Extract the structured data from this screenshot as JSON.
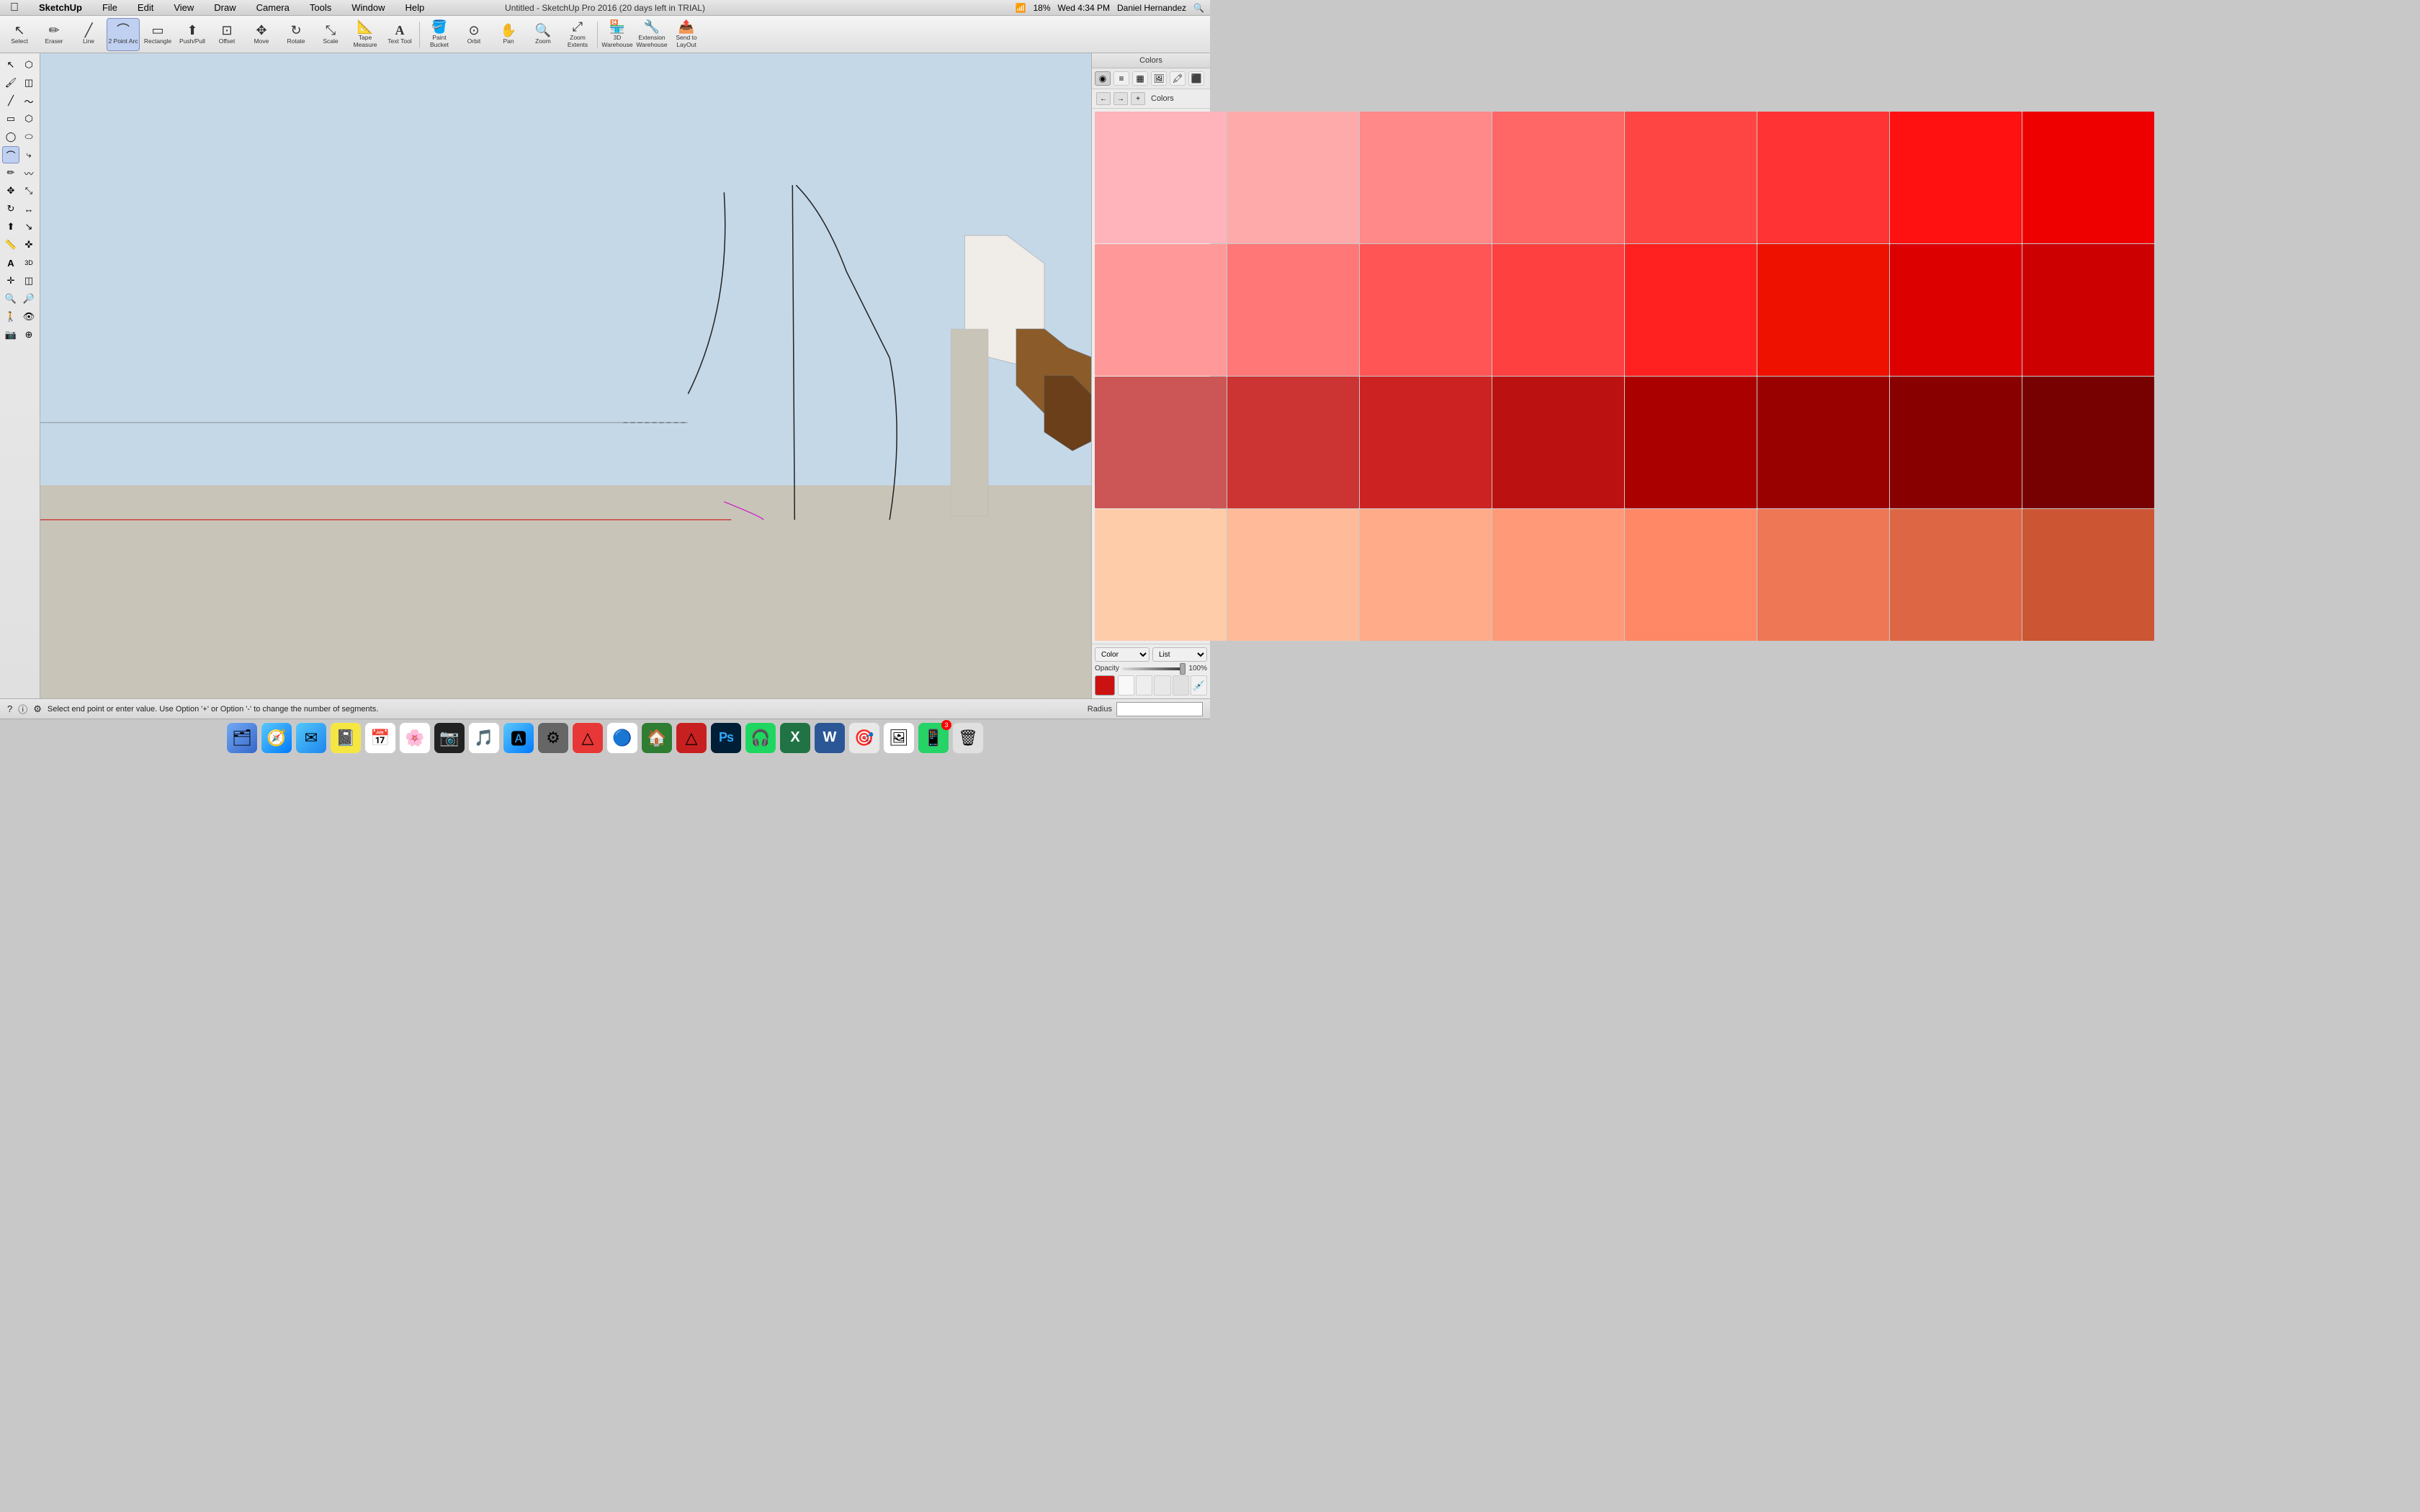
{
  "app": {
    "name": "SketchUp",
    "title": "Untitled - SketchUp Pro 2016 (20 days left in TRIAL)",
    "version": "2016"
  },
  "menubar": {
    "apple_label": "",
    "items": [
      "SketchUp",
      "File",
      "Edit",
      "View",
      "Draw",
      "Camera",
      "Tools",
      "Window",
      "Help"
    ],
    "time": "Wed 4:34 PM",
    "user": "Daniel Hernandez",
    "battery": "18%"
  },
  "toolbar": {
    "tools": [
      {
        "id": "select",
        "label": "Select",
        "icon": "↖",
        "active": false
      },
      {
        "id": "eraser",
        "label": "Eraser",
        "icon": "⌫",
        "active": false
      },
      {
        "id": "line",
        "label": "Line",
        "icon": "╱",
        "active": false
      },
      {
        "id": "2point-arc",
        "label": "2 Point Arc",
        "icon": "⌒",
        "active": true
      },
      {
        "id": "rectangle",
        "label": "Rectangle",
        "icon": "▭",
        "active": false
      },
      {
        "id": "push-pull",
        "label": "Push/Pull",
        "icon": "⬆",
        "active": false
      },
      {
        "id": "offset",
        "label": "Offset",
        "icon": "⊡",
        "active": false
      },
      {
        "id": "move",
        "label": "Move",
        "icon": "✥",
        "active": false
      },
      {
        "id": "rotate",
        "label": "Rotate",
        "icon": "↻",
        "active": false
      },
      {
        "id": "scale",
        "label": "Scale",
        "icon": "⤡",
        "active": false
      },
      {
        "id": "tape-measure",
        "label": "Tape Measure",
        "icon": "📏",
        "active": false
      },
      {
        "id": "text-tool",
        "label": "Text Tool",
        "icon": "A",
        "active": false
      },
      {
        "id": "paint-bucket",
        "label": "Paint Bucket",
        "icon": "🪣",
        "active": false
      },
      {
        "id": "orbit",
        "label": "Orbit",
        "icon": "⊙",
        "active": false
      },
      {
        "id": "pan",
        "label": "Pan",
        "icon": "✋",
        "active": false
      },
      {
        "id": "zoom",
        "label": "Zoom",
        "icon": "🔍",
        "active": false
      },
      {
        "id": "zoom-extents",
        "label": "Zoom Extents",
        "icon": "⤢",
        "active": false
      },
      {
        "id": "3d-warehouse",
        "label": "3D Warehouse",
        "icon": "🏪",
        "active": false
      },
      {
        "id": "extension-warehouse",
        "label": "Extension Warehouse",
        "icon": "🔧",
        "active": false
      },
      {
        "id": "send-to-layout",
        "label": "Send to LayOut",
        "icon": "📤",
        "active": false
      }
    ]
  },
  "left_sidebar": {
    "tools": [
      {
        "id": "select-arrow",
        "icon": "↖",
        "pair": false
      },
      {
        "id": "paint",
        "icon": "🖌",
        "pair": false
      },
      {
        "id": "line-draw",
        "icon": "╱",
        "pair": true,
        "icon2": "〜"
      },
      {
        "id": "rect-draw",
        "icon": "▭",
        "pair": true,
        "icon2": "⬡"
      },
      {
        "id": "circle-draw",
        "icon": "◯",
        "pair": true,
        "icon2": "⬡"
      },
      {
        "id": "arc-draw",
        "icon": "⌒",
        "pair": true,
        "icon2": "⤷"
      },
      {
        "id": "freehand",
        "icon": "✏",
        "pair": true,
        "icon2": "〜"
      },
      {
        "id": "move2",
        "icon": "✥",
        "pair": true,
        "icon2": "⤡"
      },
      {
        "id": "rotate2",
        "icon": "↻",
        "pair": true,
        "icon2": "↔"
      },
      {
        "id": "pushpull2",
        "icon": "⬆",
        "pair": true,
        "icon2": "⬇"
      },
      {
        "id": "tape2",
        "icon": "📏",
        "pair": true,
        "icon2": "✜"
      },
      {
        "id": "text2",
        "icon": "A",
        "pair": true,
        "icon2": "Ⓐ"
      },
      {
        "id": "axes",
        "icon": "✛",
        "pair": true,
        "icon2": "⊕"
      },
      {
        "id": "section",
        "icon": "◫",
        "pair": true,
        "icon2": "◧"
      },
      {
        "id": "iso",
        "icon": "🔍",
        "pair": true,
        "icon2": "🔎"
      },
      {
        "id": "walk",
        "icon": "🚶",
        "pair": true,
        "icon2": "👁"
      },
      {
        "id": "camera2",
        "icon": "📷",
        "pair": false
      }
    ]
  },
  "colors_panel": {
    "title": "Colors",
    "tabs": [
      {
        "id": "wheel",
        "icon": "◉"
      },
      {
        "id": "sliders",
        "icon": "≡"
      },
      {
        "id": "palette",
        "icon": "▦"
      },
      {
        "id": "image",
        "icon": "🖼"
      },
      {
        "id": "crayon",
        "icon": "✏"
      },
      {
        "id": "material",
        "icon": "⬛"
      }
    ],
    "nav_buttons": [
      "←",
      "→",
      "⊕"
    ],
    "section_label": "Colors",
    "swatches": [
      "#ffb3b3",
      "#ff9999",
      "#ff7777",
      "#ff5555",
      "#ff3333",
      "#ff1111",
      "#ff0000",
      "#ee0000",
      "#ff8888",
      "#ff6666",
      "#ff4444",
      "#ff2222",
      "#ee1111",
      "#dd0000",
      "#cc0000",
      "#bb0000",
      "#cc4444",
      "#cc3333",
      "#cc2222",
      "#bb1111",
      "#aa0000",
      "#990000",
      "#880000",
      "#770000",
      "#ffbbaa",
      "#ffaa99",
      "#ff9988",
      "#ff8877",
      "#ff7766",
      "#ee6655",
      "#dd5544",
      "#cc4433"
    ],
    "selected_swatch": "#cc0000",
    "color_dropdown_value": "Color",
    "list_dropdown_value": "List",
    "opacity_label": "Opacity",
    "opacity_value": "100%",
    "current_color": "#cc1111"
  },
  "status_bar": {
    "help_text": "Select end point or enter value. Use Option '+' or Option '-' to change the number of segments.",
    "radius_label": "Radius",
    "radius_value": ""
  },
  "dock": {
    "items": [
      {
        "id": "finder",
        "icon": "🗂",
        "label": "Finder"
      },
      {
        "id": "safari",
        "icon": "🧭",
        "label": "Safari"
      },
      {
        "id": "mail",
        "icon": "✉",
        "label": "Mail"
      },
      {
        "id": "notes",
        "icon": "📓",
        "label": "Notes"
      },
      {
        "id": "calendar",
        "icon": "📅",
        "label": "Calendar"
      },
      {
        "id": "photos",
        "icon": "🌸",
        "label": "Photos"
      },
      {
        "id": "photo-booth",
        "icon": "📷",
        "label": "Photo Booth"
      },
      {
        "id": "itunes",
        "icon": "🎵",
        "label": "iTunes"
      },
      {
        "id": "app-store",
        "icon": "🅰",
        "label": "App Store"
      },
      {
        "id": "system-prefs",
        "icon": "⚙",
        "label": "System Preferences"
      },
      {
        "id": "app1",
        "icon": "△",
        "label": "App"
      },
      {
        "id": "chrome",
        "icon": "🔵",
        "label": "Chrome"
      },
      {
        "id": "sketchup",
        "icon": "🏠",
        "label": "SketchUp"
      },
      {
        "id": "app2",
        "icon": "△",
        "label": "App"
      },
      {
        "id": "photoshop",
        "icon": "Ps",
        "label": "Photoshop"
      },
      {
        "id": "spotify",
        "icon": "🎧",
        "label": "Spotify"
      },
      {
        "id": "excel",
        "icon": "X",
        "label": "Excel"
      },
      {
        "id": "word",
        "icon": "W",
        "label": "Word"
      },
      {
        "id": "app3",
        "icon": "🎯",
        "label": "App"
      },
      {
        "id": "preview",
        "icon": "🖼",
        "label": "Preview"
      },
      {
        "id": "whatsapp",
        "icon": "📱",
        "label": "WhatsApp",
        "badge": "3"
      },
      {
        "id": "trash",
        "icon": "🗑",
        "label": "Trash"
      }
    ]
  }
}
